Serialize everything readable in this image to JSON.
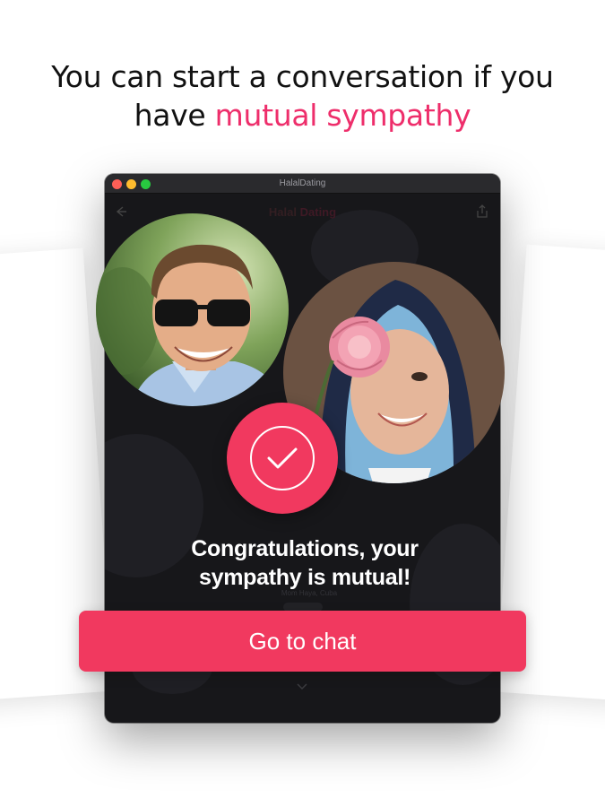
{
  "headline": {
    "line1": "You can start a conversation if you",
    "line2_prefix": "have ",
    "line2_accent": "mutual sympathy"
  },
  "window": {
    "title": "HalalDating"
  },
  "app": {
    "logo_part1": "Halal",
    "logo_part2": "Dating",
    "faint_meta": "Mom Haya, Cuba"
  },
  "match": {
    "congrats_line1": "Congratulations, your",
    "congrats_line2": "sympathy is mutual!",
    "button_label": "Go to chat"
  },
  "icons": {
    "back": "arrow-left-icon",
    "share": "share-icon",
    "check": "check-icon",
    "chevron": "chevron-down-icon"
  },
  "colors": {
    "accent": "#ee2e6b",
    "button": "#f1395f",
    "window_bg": "#17171a"
  }
}
